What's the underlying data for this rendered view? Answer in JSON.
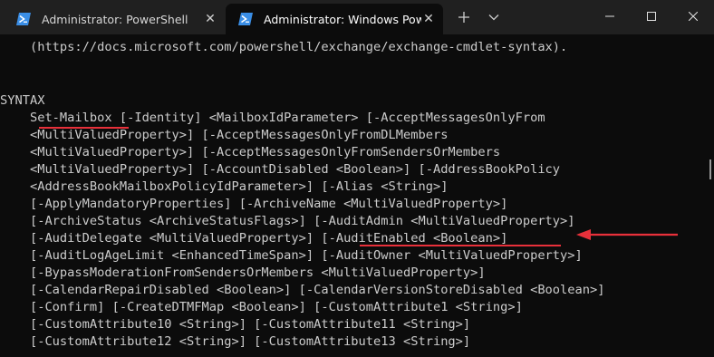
{
  "tabs": [
    {
      "label": "Administrator: PowerShell",
      "active": false
    },
    {
      "label": "Administrator: Windows PowerS",
      "active": true
    }
  ],
  "toolbar": {
    "new_tab": "+",
    "dropdown": "chevron-down-icon"
  },
  "window_controls": {
    "minimize": "minimize-icon",
    "maximize": "maximize-icon",
    "close": "close-icon"
  },
  "colors": {
    "annotation": "#e8303a",
    "terminal_bg": "#0c0c0c",
    "terminal_fg": "#cccccc"
  },
  "terminal": {
    "lines": [
      "    (https://docs.microsoft.com/powershell/exchange/exchange-cmdlet-syntax).",
      "",
      "",
      "SYNTAX",
      "    Set-Mailbox [-Identity] <MailboxIdParameter> [-AcceptMessagesOnlyFrom",
      "    <MultiValuedProperty>] [-AcceptMessagesOnlyFromDLMembers",
      "    <MultiValuedProperty>] [-AcceptMessagesOnlyFromSendersOrMembers",
      "    <MultiValuedProperty>] [-AccountDisabled <Boolean>] [-AddressBookPolicy",
      "    <AddressBookMailboxPolicyIdParameter>] [-Alias <String>]",
      "    [-ApplyMandatoryProperties] [-ArchiveName <MultiValuedProperty>]",
      "    [-ArchiveStatus <ArchiveStatusFlags>] [-AuditAdmin <MultiValuedProperty>]",
      "    [-AuditDelegate <MultiValuedProperty>] [-AuditEnabled <Boolean>]",
      "    [-AuditLogAgeLimit <EnhancedTimeSpan>] [-AuditOwner <MultiValuedProperty>]",
      "    [-BypassModerationFromSendersOrMembers <MultiValuedProperty>]",
      "    [-CalendarRepairDisabled <Boolean>] [-CalendarVersionStoreDisabled <Boolean>]",
      "    [-Confirm] [-CreateDTMFMap <Boolean>] [-CustomAttribute1 <String>]",
      "    [-CustomAttribute10 <String>] [-CustomAttribute11 <String>]",
      "    [-CustomAttribute12 <String>] [-CustomAttribute13 <String>]"
    ]
  }
}
